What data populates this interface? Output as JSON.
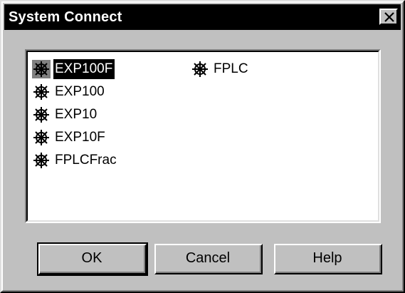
{
  "window": {
    "title": "System Connect"
  },
  "systems": {
    "items": [
      {
        "label": "EXP100F",
        "selected": true
      },
      {
        "label": "EXP100",
        "selected": false
      },
      {
        "label": "EXP10",
        "selected": false
      },
      {
        "label": "EXP10F",
        "selected": false
      },
      {
        "label": "FPLCFrac",
        "selected": false
      },
      {
        "label": "FPLC",
        "selected": false
      }
    ],
    "icon": "ship-wheel-icon"
  },
  "buttons": {
    "ok_label": "OK",
    "cancel_label": "Cancel",
    "help_label": "Help"
  },
  "colors": {
    "face": "#c0c0c0",
    "titlebar": "#000000",
    "selection": "#000000"
  }
}
